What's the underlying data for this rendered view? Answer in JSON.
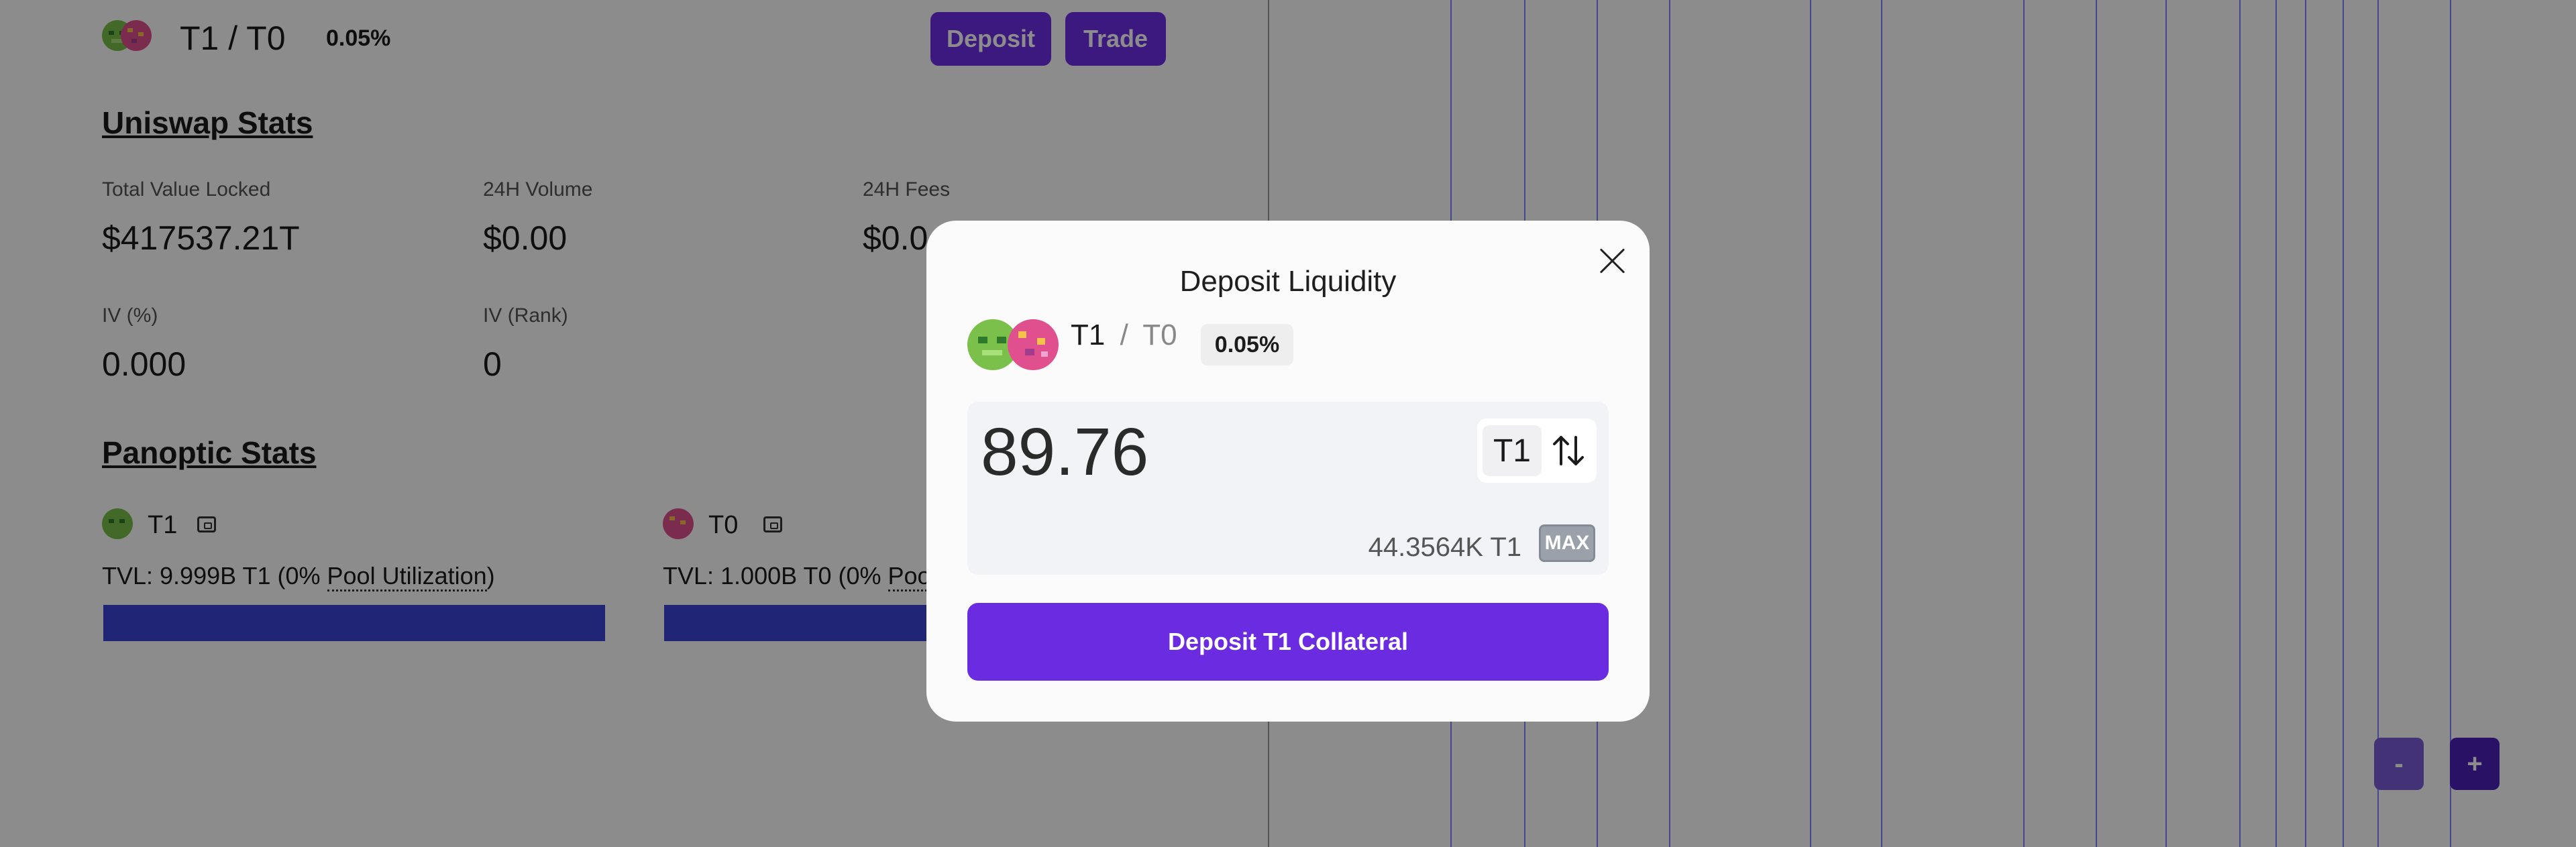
{
  "header": {
    "pair_base": "T1",
    "pair_sep": "/",
    "pair_quote": "T0",
    "fee": "0.05%",
    "deposit_label": "Deposit",
    "trade_label": "Trade"
  },
  "uniswap_stats": {
    "title": "Uniswap Stats",
    "stats": [
      {
        "label": "Total Value Locked",
        "value": "$417537.21T"
      },
      {
        "label": "24H Volume",
        "value": "$0.00"
      },
      {
        "label": "24H Fees",
        "value": "$0.0"
      },
      {
        "label": "IV (%)",
        "value": "0.000"
      },
      {
        "label": "IV (Rank)",
        "value": "0"
      }
    ]
  },
  "panoptic_stats": {
    "title": "Panoptic Stats",
    "tokens": [
      {
        "name": "T1",
        "tvl_prefix": "TVL: 9.999B T1 (0% ",
        "link": "Pool Utilization",
        "tvl_suffix": ")",
        "utilization": 0
      },
      {
        "name": "T0",
        "tvl_prefix": "TVL: 1.000B T0 (0% ",
        "link": "Pool Utilization",
        "tvl_suffix": ")",
        "utilization": 0
      }
    ]
  },
  "zoom": {
    "minus": "-",
    "plus": "+"
  },
  "modal": {
    "title": "Deposit Liquidity",
    "pair_base": "T1",
    "pair_sep": "/",
    "pair_quote": "T0",
    "fee": "0.05%",
    "amount": "89.76",
    "token": "T1",
    "balance": "44.3564K T1",
    "max_label": "MAX",
    "submit_label": "Deposit T1 Collateral"
  },
  "colors": {
    "accent": "#6b2be0",
    "bar": "#3b46d6"
  }
}
